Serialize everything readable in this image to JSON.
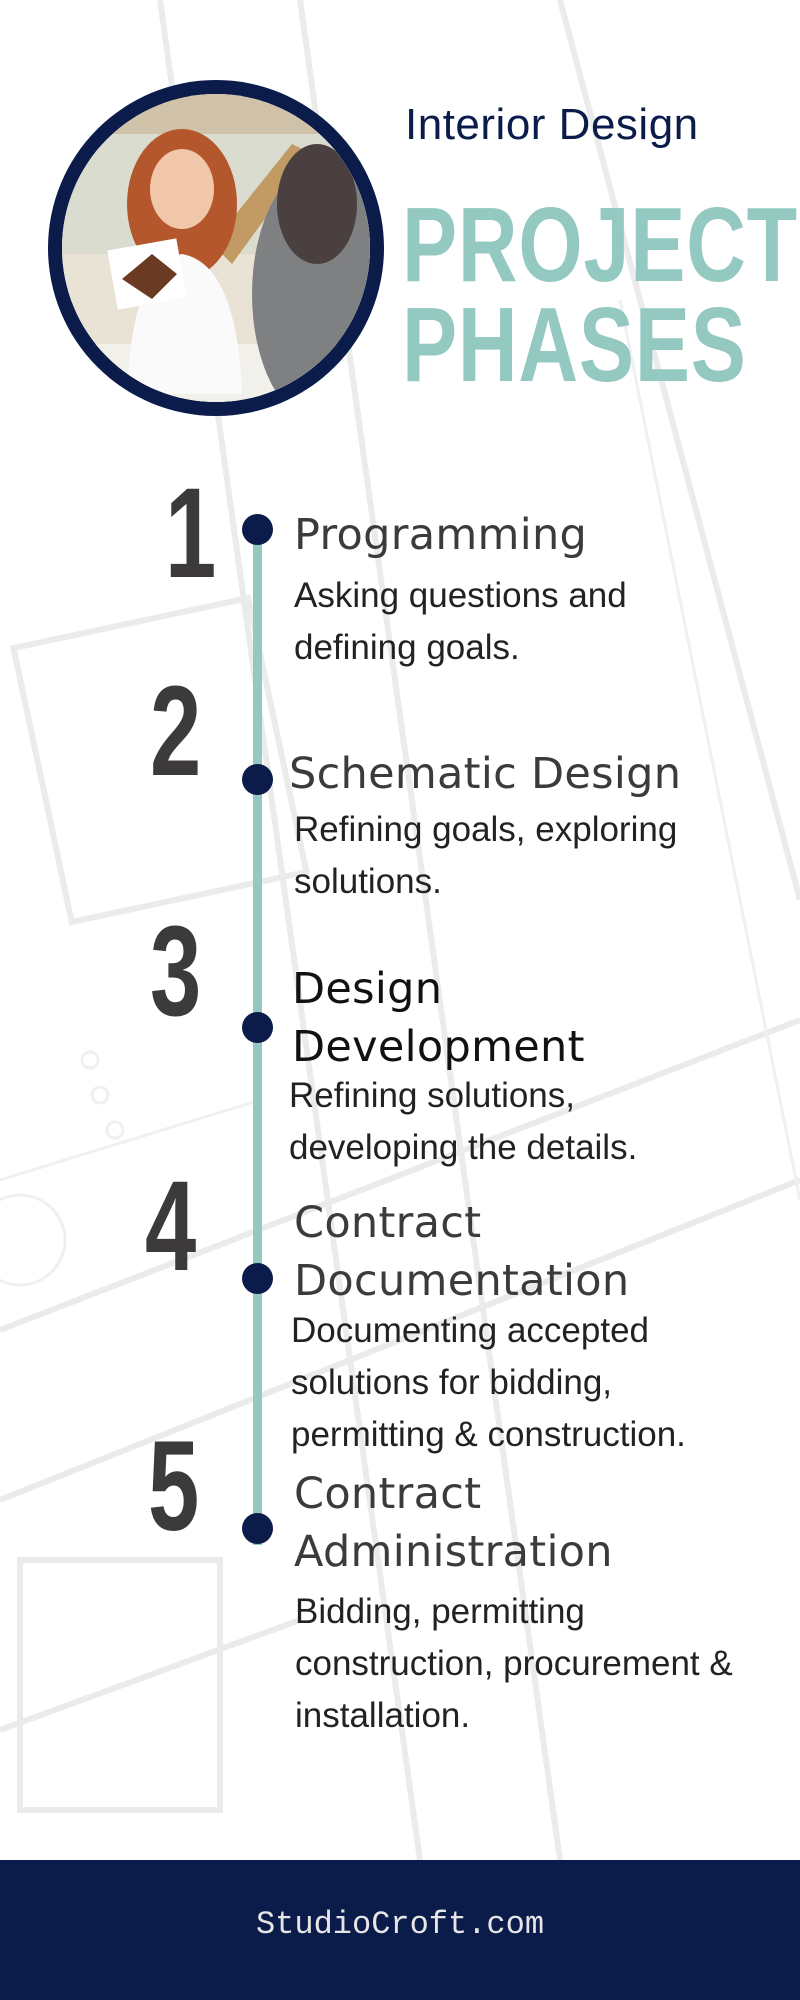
{
  "header": {
    "subtitle": "Interior Design",
    "title_line1": "PROJECT",
    "title_line2": "PHASES",
    "photo_description": "Smiling woman with curly red hair showing a 3D house model printout to a client"
  },
  "colors": {
    "navy": "#0b1c4b",
    "teal": "#93c9c0",
    "number_gray": "#3d3a3c"
  },
  "phases": [
    {
      "number": "1",
      "title": "Programming",
      "description": "Asking questions and defining goals."
    },
    {
      "number": "2",
      "title": "Schematic Design",
      "description": "Refining goals, exploring solutions."
    },
    {
      "number": "3",
      "title": "Design Development",
      "description": "Refining solutions, developing the details."
    },
    {
      "number": "4",
      "title": "Contract Documentation",
      "description": "Documenting accepted solutions for bidding, permitting & construction."
    },
    {
      "number": "5",
      "title": "Contract Administration",
      "description": "Bidding, permitting construction, procurement & installation."
    }
  ],
  "footer": {
    "website": "StudioCroft.com"
  }
}
